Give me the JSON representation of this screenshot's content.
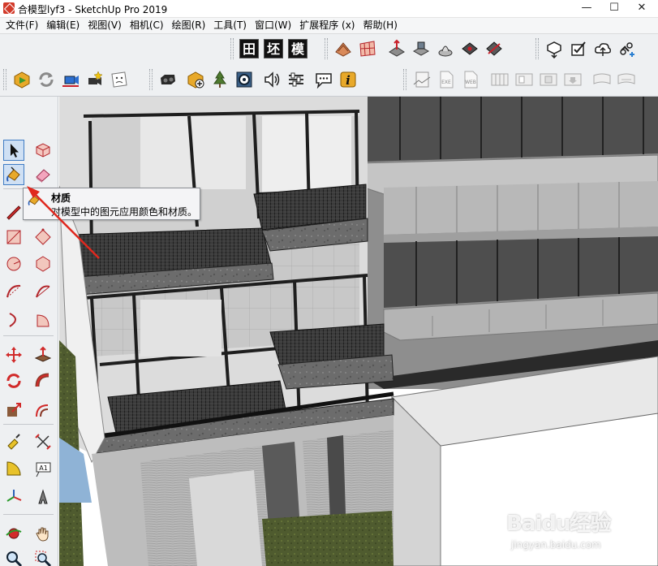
{
  "window": {
    "title": "合模型lyf3 - SketchUp Pro 2019",
    "minimize_glyph": "—",
    "maximize_glyph": "☐",
    "close_glyph": "✕"
  },
  "menu": [
    "文件(F)",
    "编辑(E)",
    "视图(V)",
    "相机(C)",
    "绘图(R)",
    "工具(T)",
    "窗口(W)",
    "扩展程序 (x)",
    "帮助(H)"
  ],
  "toolbar_kanji": [
    "田",
    "坯",
    "模"
  ],
  "tooltip": {
    "title": "材质",
    "description": "对模型中的图元应用颜色和材质。"
  },
  "palette": {
    "text_tool_label": "A1"
  },
  "watermark": {
    "logo": "Baidu经验",
    "url": "jingyan.baidu.com"
  },
  "colors": {
    "annotation_arrow": "#e0281e",
    "active_tool_highlight": "#cfe0f4",
    "toolbar_bg": "#eef0f2"
  }
}
